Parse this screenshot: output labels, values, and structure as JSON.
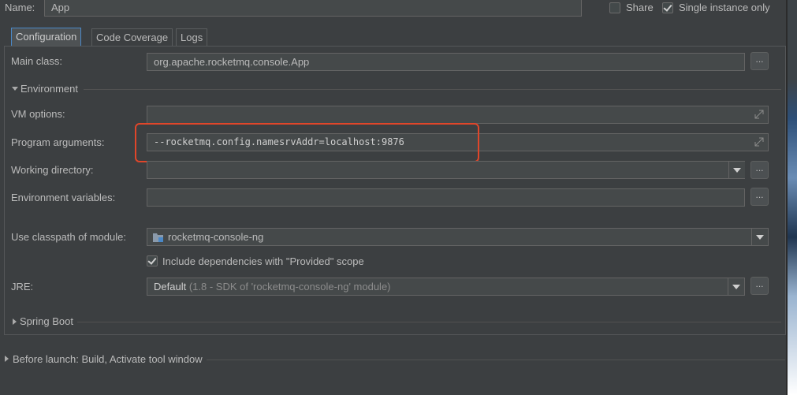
{
  "header": {
    "name_label": "Name:",
    "name_value": "App",
    "share_label": "Share",
    "share_checked": false,
    "single_instance_label": "Single instance only",
    "single_instance_checked": true
  },
  "tabs": [
    {
      "label": "Configuration",
      "active": true
    },
    {
      "label": "Code Coverage",
      "active": false
    },
    {
      "label": "Logs",
      "active": false
    }
  ],
  "config": {
    "main_class_label": "Main class:",
    "main_class_value": "org.apache.rocketmq.console.App",
    "environment_label": "Environment",
    "vm_options_label": "VM options:",
    "vm_options_value": "",
    "program_args_label": "Program arguments:",
    "program_args_value": "--rocketmq.config.namesrvAddr=localhost:9876",
    "working_dir_label": "Working directory:",
    "working_dir_value": "",
    "env_vars_label": "Environment variables:",
    "env_vars_value": "",
    "classpath_label": "Use classpath of module:",
    "classpath_value": "rocketmq-console-ng",
    "include_deps_label": "Include dependencies with \"Provided\" scope",
    "include_deps_checked": true,
    "jre_label": "JRE:",
    "jre_value": "Default",
    "jre_hint": "(1.8 - SDK of 'rocketmq-console-ng' module)",
    "spring_boot_label": "Spring Boot",
    "browse_button_label": "..."
  },
  "before_launch": {
    "label": "Before launch: Build, Activate tool window"
  },
  "colors": {
    "background": "#3c3f41",
    "field_background": "#45494a",
    "highlight_box": "#e0462a",
    "tab_active_border": "#4a88c7"
  }
}
